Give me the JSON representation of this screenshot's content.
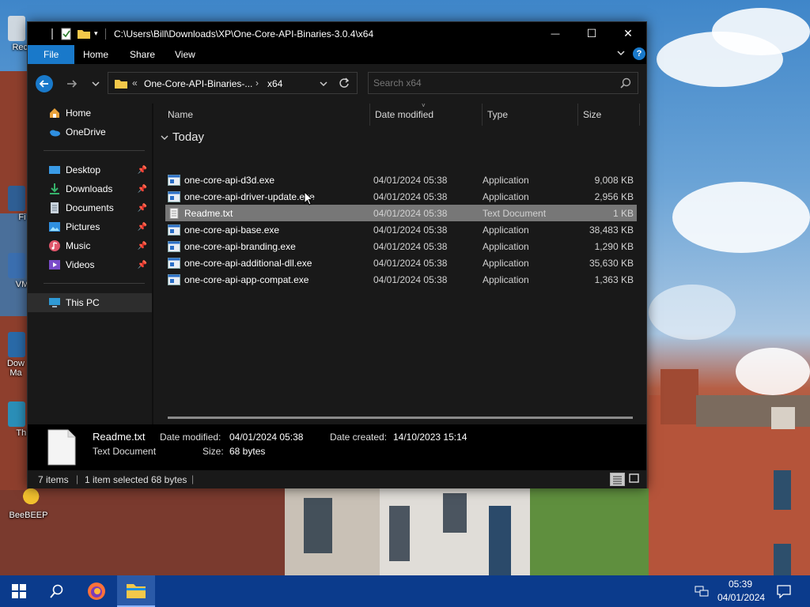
{
  "desktop": {
    "icons": [
      {
        "label": "Recy"
      },
      {
        "label": "Fi"
      },
      {
        "label": "VM"
      },
      {
        "label": "Dow Ma"
      },
      {
        "label": "Thi"
      },
      {
        "label": "BeeBEEP"
      }
    ]
  },
  "window": {
    "title": "C:\\Users\\Bill\\Downloads\\XP\\One-Core-API-Binaries-3.0.4\\x64",
    "controls": {
      "minimize": "—",
      "maximize": "☐",
      "close": "✕"
    }
  },
  "ribbon": {
    "tabs": [
      "File",
      "Home",
      "Share",
      "View"
    ],
    "help": "?"
  },
  "address": {
    "overflow": "«",
    "crumbs": [
      "One-Core-API-Binaries-...",
      "x64"
    ],
    "search_placeholder": "Search x64"
  },
  "nav": {
    "items": [
      {
        "label": "Home",
        "icon": "home-icon",
        "pinned": false
      },
      {
        "label": "OneDrive",
        "icon": "onedrive-icon",
        "pinned": false
      },
      {
        "label": "Desktop",
        "icon": "desktop-icon",
        "pinned": true
      },
      {
        "label": "Downloads",
        "icon": "downloads-icon",
        "pinned": true
      },
      {
        "label": "Documents",
        "icon": "documents-icon",
        "pinned": true
      },
      {
        "label": "Pictures",
        "icon": "pictures-icon",
        "pinned": true
      },
      {
        "label": "Music",
        "icon": "music-icon",
        "pinned": true
      },
      {
        "label": "Videos",
        "icon": "videos-icon",
        "pinned": true
      },
      {
        "label": "This PC",
        "icon": "this-pc-icon",
        "pinned": false
      }
    ]
  },
  "columns": {
    "name": "Name",
    "date": "Date modified",
    "type": "Type",
    "size": "Size"
  },
  "group_label": "Today",
  "files": [
    {
      "name": "one-core-api-d3d.exe",
      "date": "04/01/2024 05:38",
      "type": "Application",
      "size": "9,008 KB"
    },
    {
      "name": "one-core-api-driver-update.exe",
      "date": "04/01/2024 05:38",
      "type": "Application",
      "size": "2,956 KB"
    },
    {
      "name": "Readme.txt",
      "date": "04/01/2024 05:38",
      "type": "Text Document",
      "size": "1 KB"
    },
    {
      "name": "one-core-api-base.exe",
      "date": "04/01/2024 05:38",
      "type": "Application",
      "size": "38,483 KB"
    },
    {
      "name": "one-core-api-branding.exe",
      "date": "04/01/2024 05:38",
      "type": "Application",
      "size": "1,290 KB"
    },
    {
      "name": "one-core-api-additional-dll.exe",
      "date": "04/01/2024 05:38",
      "type": "Application",
      "size": "35,630 KB"
    },
    {
      "name": "one-core-api-app-compat.exe",
      "date": "04/01/2024 05:38",
      "type": "Application",
      "size": "1,363 KB"
    }
  ],
  "selected_file_index": 2,
  "details": {
    "name": "Readme.txt",
    "type": "Text Document",
    "modified_label": "Date modified:",
    "modified_value": "04/01/2024 05:38",
    "created_label": "Date created:",
    "created_value": "14/10/2023 15:14",
    "size_label": "Size:",
    "size_value": "68 bytes"
  },
  "status": {
    "items": "7 items",
    "selected": "1 item selected",
    "selected_size": "68 bytes"
  },
  "taskbar": {
    "time": "05:39",
    "date": "04/01/2024"
  },
  "colors": {
    "accent": "#1979ca",
    "taskbar": "#0b3b8c",
    "selected_row": "#777777"
  }
}
